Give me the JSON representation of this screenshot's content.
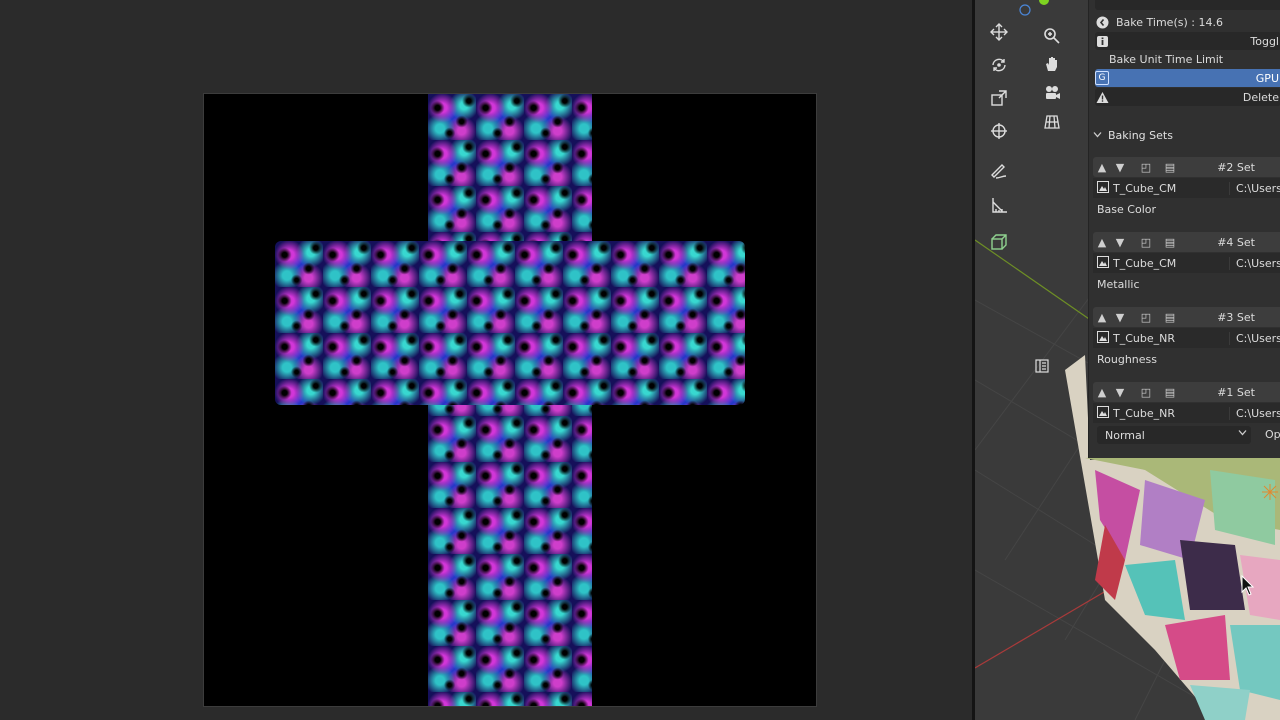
{
  "bake_panel": {
    "bake_time_label": "Bake Time(s) : 14.6",
    "toggle_label": "Toggl",
    "unit_time_limit_label": "Bake Unit Time Limit",
    "gpu_label": "GPU",
    "gpu_key": "G",
    "delete_label": "Delete",
    "baking_sets_header": "Baking Sets",
    "sets": [
      {
        "title": "#2 Set",
        "texture": "T_Cube_CM",
        "path": "C:\\Users\\u",
        "channel": "Base Color"
      },
      {
        "title": "#4 Set",
        "texture": "T_Cube_CM",
        "path": "C:\\Users\\u",
        "channel": "Metallic"
      },
      {
        "title": "#3 Set",
        "texture": "T_Cube_NR",
        "path": "C:\\Users\\u",
        "channel": "Roughness"
      },
      {
        "title": "#1 Set",
        "texture": "T_Cube_NR",
        "path": "C:\\Users\\u",
        "channel": "Normal",
        "open_label": "Open"
      }
    ]
  },
  "toolbar": {
    "tools": [
      "move-icon",
      "rotate-icon",
      "scale-icon",
      "transform-icon",
      "annotate-icon",
      "measure-icon",
      "add-cube-icon"
    ],
    "nav": [
      "zoom-icon",
      "pan-hand-icon",
      "camera-icon",
      "grid-view-icon"
    ]
  },
  "colors": {
    "accent_blue": "#4772b3",
    "panel_bg": "#303030",
    "editor_bg": "#2b2b2b",
    "texture_magenta": "#d236d8",
    "texture_cyan": "#38d8d0",
    "texture_blue": "#2438c8"
  }
}
